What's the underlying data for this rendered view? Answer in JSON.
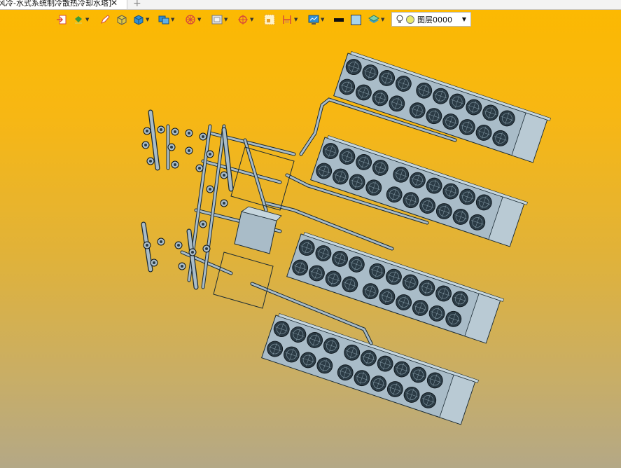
{
  "tabs": [
    {
      "title": "风冷-水式系统制冷散热冷却水塔]",
      "close": "✕"
    }
  ],
  "new_tab": "+",
  "toolbar": {
    "tools": [
      {
        "name": "exit-icon",
        "color": "#d84b3a"
      },
      {
        "name": "paint-bucket-icon",
        "color": "#3a9a3a"
      },
      {
        "name": "pencil-icon",
        "color": "#d84b3a"
      },
      {
        "name": "cube-yellow-icon",
        "color": "#e3c83c"
      },
      {
        "name": "cube-blue-icon",
        "color": "#2f8fd4"
      },
      {
        "name": "cube-stack-icon",
        "color": "#2f8fd4"
      },
      {
        "name": "sphere-grid-icon",
        "color": "#d84b3a"
      },
      {
        "name": "frame-icon",
        "color": "#777777"
      },
      {
        "name": "target-icon",
        "color": "#d84b3a"
      },
      {
        "name": "dotted-square-icon",
        "color": "#e6a12a"
      },
      {
        "name": "dimension-icon",
        "color": "#d84b3a"
      },
      {
        "name": "monitor-icon",
        "color": "#2f8fd4"
      }
    ],
    "line_color": "#111111",
    "fill_color": "#a7d3ea",
    "layers_icon": "layers-icon"
  },
  "layer_select": {
    "value": "图层0000"
  },
  "scene": {
    "background_top": "#fcb900",
    "background_bottom": "#b4a886",
    "equipment_color": "#a9bcc8"
  }
}
